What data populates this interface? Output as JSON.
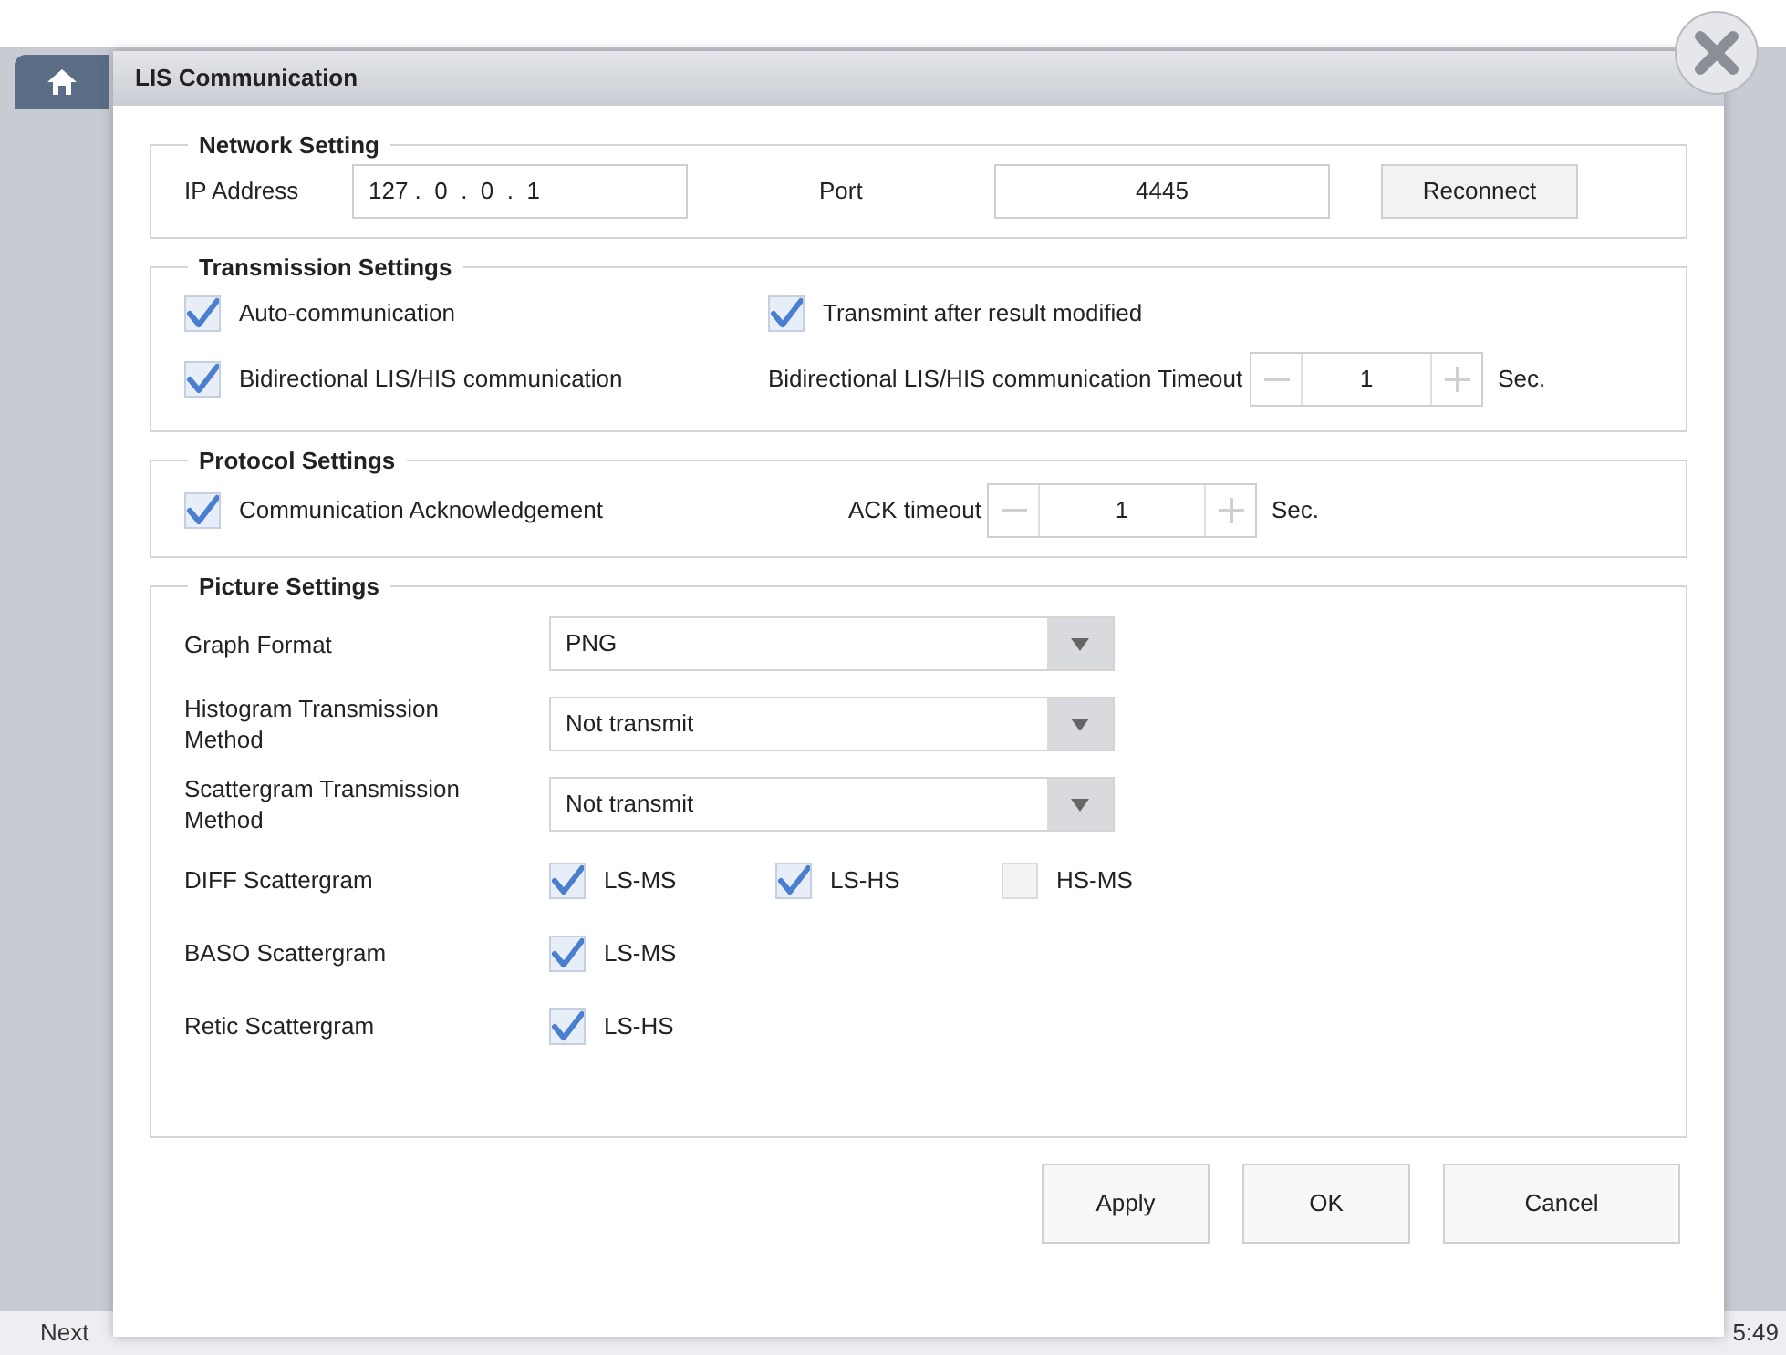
{
  "window": {
    "title": "LIS Communication"
  },
  "network_setting": {
    "title": "Network Setting",
    "ip_address": {
      "label": "IP Address",
      "value": "127 .  0  .  0  .  1"
    },
    "port": {
      "label": "Port",
      "value": "4445"
    },
    "reconnect_button": "Reconnect"
  },
  "transmission_settings": {
    "title": "Transmission Settings",
    "auto_communication": {
      "label": "Auto-communication",
      "checked": true
    },
    "transmit_after_modified": {
      "label": "Transmint after result modified",
      "checked": true
    },
    "bidirectional": {
      "label": "Bidirectional LIS/HIS communication",
      "checked": true
    },
    "timeout": {
      "label": "Bidirectional LIS/HIS communication Timeout",
      "value": "1",
      "unit": "Sec."
    }
  },
  "protocol_settings": {
    "title": "Protocol Settings",
    "acknowledgement": {
      "label": "Communication Acknowledgement",
      "checked": true
    },
    "ack_timeout": {
      "label": "ACK timeout",
      "value": "1",
      "unit": "Sec."
    }
  },
  "picture_settings": {
    "title": "Picture Settings",
    "dropdowns": [
      {
        "label": "Graph Format",
        "value": "PNG"
      },
      {
        "label": "Histogram Transmission Method",
        "value": "Not transmit"
      },
      {
        "label": "Scattergram Transmission Method",
        "value": "Not transmit"
      }
    ],
    "scattergrams": [
      {
        "label": "DIFF Scattergram",
        "options": [
          {
            "label": "LS-MS",
            "checked": true
          },
          {
            "label": "LS-HS",
            "checked": true
          },
          {
            "label": "HS-MS",
            "checked": false
          }
        ]
      },
      {
        "label": "BASO Scattergram",
        "options": [
          {
            "label": "LS-MS",
            "checked": true
          }
        ]
      },
      {
        "label": "Retic Scattergram",
        "options": [
          {
            "label": "LS-HS",
            "checked": true
          }
        ]
      }
    ]
  },
  "buttons": [
    "Apply",
    "OK",
    "Cancel"
  ],
  "status_bar": {
    "left": "Next",
    "right": "5:49"
  }
}
